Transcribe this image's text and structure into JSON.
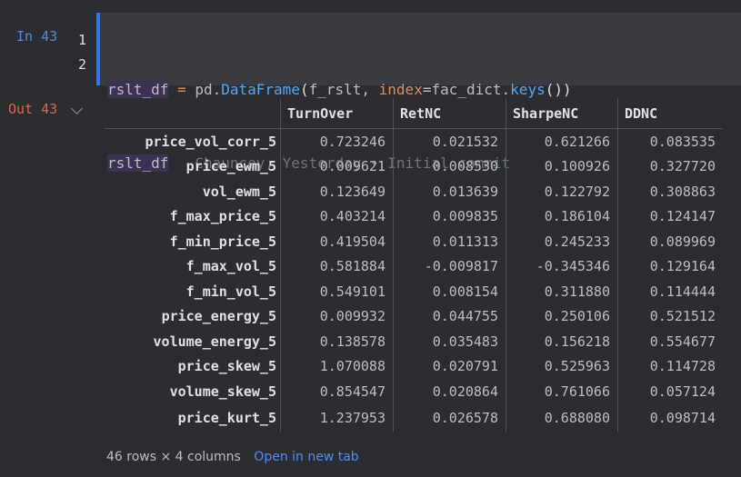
{
  "cell": {
    "in_label": "In 43",
    "out_label": "Out 43",
    "line_numbers": [
      "1",
      "2"
    ],
    "code": {
      "line1": {
        "var": "rslt_df",
        "op": " = ",
        "module": "pd.",
        "func": "DataFrame",
        "open": "(",
        "arg1": "f_rslt, ",
        "kwarg": "index",
        "eq": "=",
        "arg2": "fac_dict.",
        "method": "keys",
        "close": "())"
      },
      "line2": {
        "var": "rslt_df",
        "blame": "   Chauncey, Yesterday • Initial commit"
      }
    }
  },
  "table": {
    "columns": [
      "TurnOver",
      "RetNC",
      "SharpeNC",
      "DDNC"
    ],
    "rows": [
      {
        "index": "price_vol_corr_5",
        "values": [
          "0.723246",
          "0.021532",
          "0.621266",
          "0.083535"
        ]
      },
      {
        "index": "price_ewm_5",
        "values": [
          "0.009621",
          "0.008530",
          "0.100926",
          "0.327720"
        ]
      },
      {
        "index": "vol_ewm_5",
        "values": [
          "0.123649",
          "0.013639",
          "0.122792",
          "0.308863"
        ]
      },
      {
        "index": "f_max_price_5",
        "values": [
          "0.403214",
          "0.009835",
          "0.186104",
          "0.124147"
        ]
      },
      {
        "index": "f_min_price_5",
        "values": [
          "0.419504",
          "0.011313",
          "0.245233",
          "0.089969"
        ]
      },
      {
        "index": "f_max_vol_5",
        "values": [
          "0.581884",
          "-0.009817",
          "-0.345346",
          "0.129164"
        ]
      },
      {
        "index": "f_min_vol_5",
        "values": [
          "0.549101",
          "0.008154",
          "0.311880",
          "0.114444"
        ]
      },
      {
        "index": "price_energy_5",
        "values": [
          "0.009932",
          "0.044755",
          "0.250106",
          "0.521512"
        ]
      },
      {
        "index": "volume_energy_5",
        "values": [
          "0.138578",
          "0.035483",
          "0.156218",
          "0.554677"
        ]
      },
      {
        "index": "price_skew_5",
        "values": [
          "1.070088",
          "0.020791",
          "0.525963",
          "0.114728"
        ]
      },
      {
        "index": "volume_skew_5",
        "values": [
          "0.854547",
          "0.020864",
          "0.761066",
          "0.057124"
        ]
      },
      {
        "index": "price_kurt_5",
        "values": [
          "1.237953",
          "0.026578",
          "0.688080",
          "0.098714"
        ]
      }
    ]
  },
  "footer": {
    "summary": "46 rows × 4 columns",
    "open_link": "Open in new tab"
  }
}
